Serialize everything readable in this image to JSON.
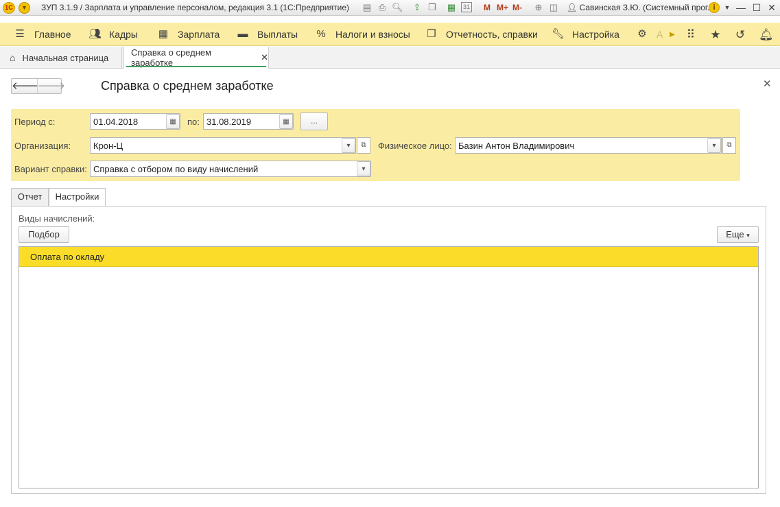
{
  "titlebar": {
    "logo": "1С",
    "title": "ЗУП 3.1.9 / Зарплата и управление персоналом, редакция 3.1  (1С:Предприятие)",
    "m_labels": [
      "M",
      "M+",
      "M-"
    ],
    "user": "Савинская З.Ю. (Системный прог...",
    "calendar_day": "31"
  },
  "sections": [
    {
      "label": "Главное",
      "icon": "menu-icon"
    },
    {
      "label": "Кадры",
      "icon": "people-icon"
    },
    {
      "label": "Зарплата",
      "icon": "calculator-icon"
    },
    {
      "label": "Выплаты",
      "icon": "wallet-icon"
    },
    {
      "label": "Налоги и взносы",
      "icon": "percent-icon"
    },
    {
      "label": "Отчетность, справки",
      "icon": "documents-icon"
    },
    {
      "label": "Настройка",
      "icon": "wrench-icon"
    },
    {
      "label": "А",
      "icon": "gear-icon"
    }
  ],
  "tabs": {
    "home": "Начальная страница",
    "doc": "Справка о среднем заработке"
  },
  "form": {
    "title": "Справка о среднем заработке",
    "period_from_label": "Период с:",
    "period_from": "01.04.2018",
    "period_to_label": "по:",
    "period_to": "31.08.2019",
    "dots_label": "...",
    "org_label": "Организация:",
    "org_value": "Крон-Ц",
    "person_label": "Физическое лицо:",
    "person_value": "Базин Антон Владимирович",
    "variant_label": "Вариант справки:",
    "variant_value": "Справка с отбором по виду начислений"
  },
  "report_tabs": [
    "Отчет",
    "Настройки"
  ],
  "settings": {
    "accruals_label": "Виды начислений:",
    "select_button": "Подбор",
    "more_button": "Еще",
    "rows": [
      "Оплата по окладу"
    ]
  },
  "colors": {
    "section_bar": "#fbeda3",
    "params_bg": "#fbeca3",
    "selected_row": "#fbdd29",
    "tab_underline": "#3ea05f"
  }
}
